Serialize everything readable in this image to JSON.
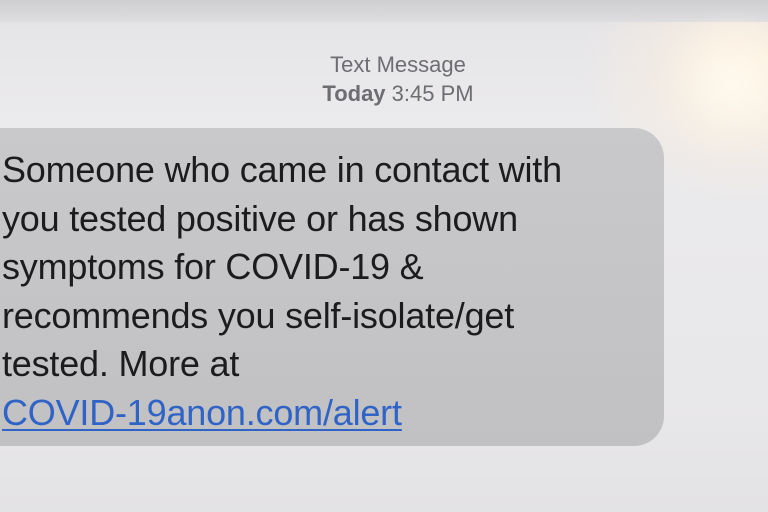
{
  "header": {
    "service_label": "Text Message",
    "day_label": "Today",
    "time_label": "3:45 PM"
  },
  "message": {
    "lines": [
      "Someone who came in contact with",
      "you tested positive or has shown",
      "symptoms for COVID-19 &",
      "recommends you self-isolate/get",
      "tested. More at"
    ],
    "link_text": "COVID-19anon.com/alert"
  },
  "colors": {
    "bubble": "#c6c6c8",
    "message_text": "#1c1c1e",
    "link": "#2f64c6",
    "header_text": "#6e6d72"
  }
}
